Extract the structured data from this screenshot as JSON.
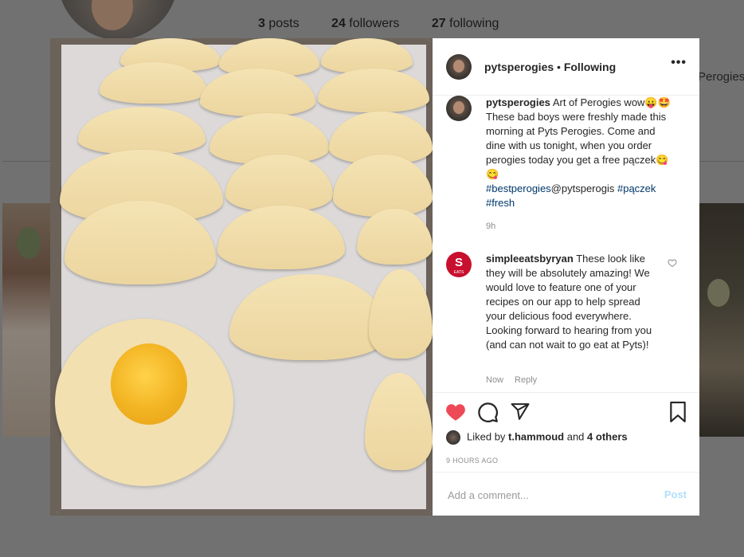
{
  "profile_bg": {
    "posts_count": "3",
    "posts_label": " posts",
    "followers_count": "24",
    "followers_label": " followers",
    "following_count": "27",
    "following_label": " following",
    "right_text": "Perogies"
  },
  "post": {
    "username": "pytsperogies",
    "separator": " • ",
    "follow_status": "Following",
    "more_icon": "more-horizontal-icon",
    "caption": {
      "username": "pytsperogies",
      "text": "Art of Perogies wow😛🤩 These bad boys were freshly made this morning at Pyts Perogies. Come and dine with us tonight, when you order perogies today you get a free pączek😋😋",
      "hashtag1": "#bestperogies",
      "mention": "@pytsperogis",
      "hashtag2": "#pączek",
      "hashtag3": "#fresh",
      "time": "9h"
    },
    "comment": {
      "avatar_letter": "S",
      "avatar_sub": "EATS",
      "username": "simpleeatsbyryan",
      "text": "These look like they will be absolutely amazing! We would love to feature one of your recipes on our app to help spread your delicious food everywhere. Looking forward to hearing from you (and can not wait to go eat at Pyts)!",
      "time": "Now",
      "reply_label": "Reply"
    },
    "likes": {
      "prefix": "Liked by ",
      "user": "t.hammoud",
      "middle": " and ",
      "others": "4 others"
    },
    "timestamp": "9 HOURS AGO",
    "comment_placeholder": "Add a comment...",
    "post_button": "Post",
    "liked": true,
    "colors": {
      "like_red": "#ed4956",
      "post_disabled": "#b2dffc",
      "tag_blue": "#00376b"
    }
  }
}
